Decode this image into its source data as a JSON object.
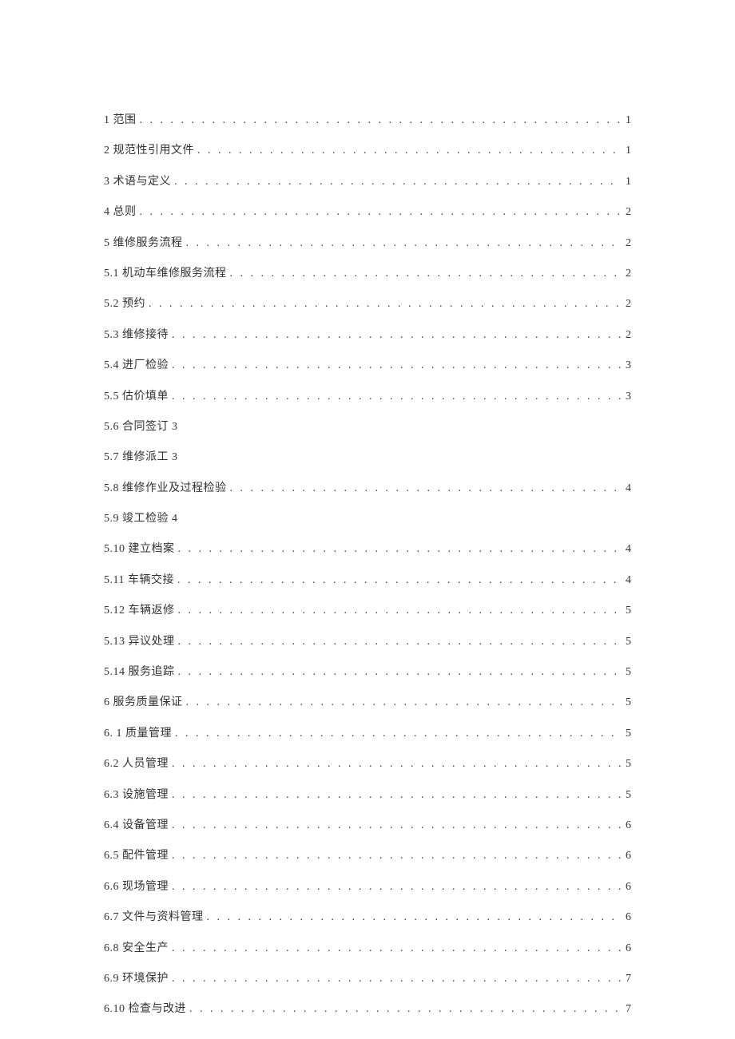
{
  "toc": [
    {
      "label": "1 范围",
      "page": "1",
      "hasLeader": true
    },
    {
      "label": "2 规范性引用文件",
      "page": "1",
      "hasLeader": true
    },
    {
      "label": "3 术语与定义",
      "page": "1",
      "hasLeader": true
    },
    {
      "label": "4   总则",
      "page": "2",
      "hasLeader": true
    },
    {
      "label": "5   维修服务流程",
      "page": "2",
      "hasLeader": true
    },
    {
      "label": "5.1    机动车维修服务流程",
      "page": "2",
      "hasLeader": true
    },
    {
      "label": "5.2    预约",
      "page": "2",
      "hasLeader": true
    },
    {
      "label": "5.3    维修接待",
      "page": "2",
      "hasLeader": true
    },
    {
      "label": "5.4    进厂检验",
      "page": "3",
      "hasLeader": true
    },
    {
      "label": "5.5    估价填单",
      "page": "3",
      "hasLeader": true
    },
    {
      "label": "5.6    合同签订  3",
      "page": "",
      "hasLeader": false
    },
    {
      "label": "5.7    维修派工  3",
      "page": "",
      "hasLeader": false
    },
    {
      "label": "5.8    维修作业及过程检验",
      "page": "4",
      "hasLeader": true
    },
    {
      "label": "5.9    竣工检验  4",
      "page": "",
      "hasLeader": false
    },
    {
      "label": "5.10 建立档案",
      "page": "4",
      "hasLeader": true
    },
    {
      "label": "5.11 车辆交接",
      "page": "4",
      "hasLeader": true
    },
    {
      "label": "5.12 车辆返修",
      "page": "5",
      "hasLeader": true
    },
    {
      "label": "5.13 异议处理",
      "page": "5",
      "hasLeader": true
    },
    {
      "label": "5.14 服务追踪",
      "page": "5",
      "hasLeader": true
    },
    {
      "label": "6 服务质量保证",
      "page": "5",
      "hasLeader": true
    },
    {
      "label": "6.   1 质量管理",
      "page": "5",
      "hasLeader": true
    },
    {
      "label": "6.2    人员管理",
      "page": "5",
      "hasLeader": true
    },
    {
      "label": "6.3    设施管理",
      "page": "5",
      "hasLeader": true
    },
    {
      "label": "6.4    设备管理",
      "page": "6",
      "hasLeader": true
    },
    {
      "label": "6.5    配件管理",
      "page": "6",
      "hasLeader": true
    },
    {
      "label": "6.6    现场管理",
      "page": "6",
      "hasLeader": true
    },
    {
      "label": "6.7    文件与资料管理",
      "page": "6",
      "hasLeader": true
    },
    {
      "label": "6.8    安全生产",
      "page": "6",
      "hasLeader": true
    },
    {
      "label": "6.9    环境保护",
      "page": "7",
      "hasLeader": true
    },
    {
      "label": "6.10 检查与改进",
      "page": "7",
      "hasLeader": true
    }
  ]
}
